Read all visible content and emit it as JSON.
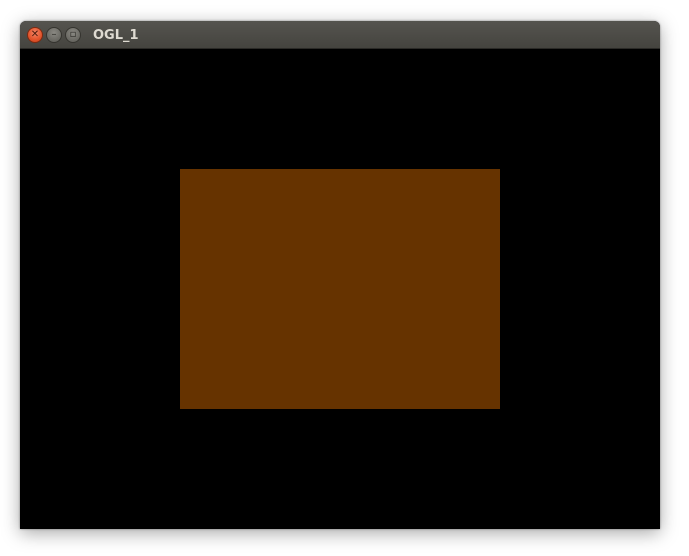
{
  "window": {
    "title": "OGL_1",
    "controls": {
      "close_icon": "close-icon",
      "minimize_icon": "minimize-icon",
      "maximize_icon": "maximize-icon"
    }
  },
  "canvas": {
    "background_color": "#000000",
    "quad_color": "#663300"
  }
}
